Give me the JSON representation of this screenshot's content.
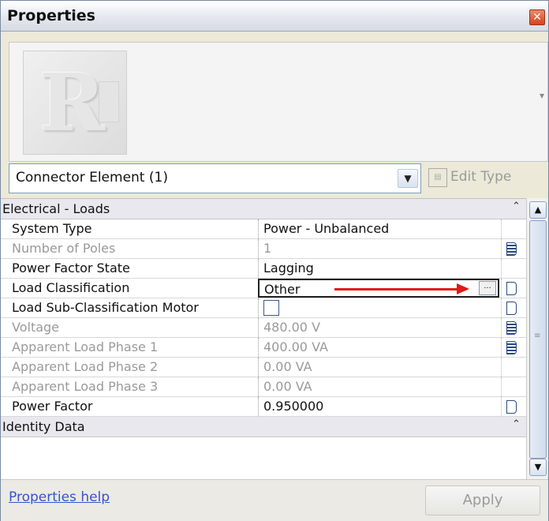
{
  "panel": {
    "title": "Properties",
    "close_glyph": "✕"
  },
  "preview": {
    "logo_glyph": "R"
  },
  "type_selector": {
    "value": "Connector Element (1)",
    "edit_type_label": "Edit Type"
  },
  "categories": [
    {
      "label": "Electrical - Loads"
    },
    {
      "label": "Identity Data"
    }
  ],
  "rows": [
    {
      "name": "System Type",
      "value": "Power - Unbalanced"
    },
    {
      "name": "Number of Poles",
      "value": "1"
    },
    {
      "name": "Power Factor State",
      "value": "Lagging"
    },
    {
      "name": "Load Classification",
      "value": "Other",
      "browse": "..."
    },
    {
      "name": "Load Sub-Classification Motor",
      "value": ""
    },
    {
      "name": "Voltage",
      "value": "480.00 V"
    },
    {
      "name": "Apparent Load Phase 1",
      "value": "400.00 VA"
    },
    {
      "name": "Apparent Load Phase 2",
      "value": "0.00 VA"
    },
    {
      "name": "Apparent Load Phase 3",
      "value": "0.00 VA"
    },
    {
      "name": "Power Factor",
      "value": "0.950000"
    }
  ],
  "footer": {
    "help_link": "Properties help",
    "apply_label": "Apply"
  },
  "colors": {
    "annotation_arrow": "#e01818",
    "link": "#3355cc"
  }
}
